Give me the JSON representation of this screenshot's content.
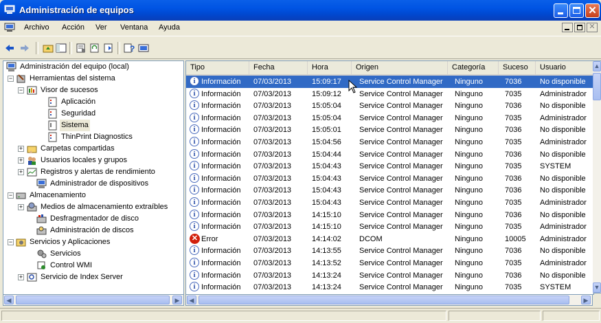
{
  "window": {
    "title": "Administración de equipos"
  },
  "menu": [
    "Archivo",
    "Acción",
    "Ver",
    "Ventana",
    "Ayuda"
  ],
  "toolbar": {
    "icons": [
      "back-arrow-icon",
      "forward-arrow-icon",
      "up-folder-icon",
      "show-tree-icon",
      "properties-icon",
      "refresh-icon",
      "export-icon",
      "help-icon",
      "console-icon"
    ]
  },
  "tree": {
    "root": "Administración del equipo (local)",
    "items": [
      "Herramientas del sistema",
      "Visor de sucesos",
      "Aplicación",
      "Seguridad",
      "Sistema",
      "ThinPrint Diagnostics",
      "Carpetas compartidas",
      "Usuarios locales y grupos",
      "Registros y alertas de rendimiento",
      "Administrador de dispositivos",
      "Almacenamiento",
      "Medios de almacenamiento extraíbles",
      "Desfragmentador de disco",
      "Administración de discos",
      "Servicios y Aplicaciones",
      "Servicios",
      "Control WMI",
      "Servicio de Index Server"
    ]
  },
  "columns": [
    "Tipo",
    "Fecha",
    "Hora",
    "Origen",
    "Categoría",
    "Suceso",
    "Usuario"
  ],
  "rows": [
    {
      "tipo": "Información",
      "fecha": "07/03/2013",
      "hora": "15:09:17",
      "origen": "Service Control Manager",
      "categoria": "Ninguno",
      "suceso": "7036",
      "usuario": "No disponible"
    },
    {
      "tipo": "Información",
      "fecha": "07/03/2013",
      "hora": "15:09:12",
      "origen": "Service Control Manager",
      "categoria": "Ninguno",
      "suceso": "7035",
      "usuario": "Administrador"
    },
    {
      "tipo": "Información",
      "fecha": "07/03/2013",
      "hora": "15:05:04",
      "origen": "Service Control Manager",
      "categoria": "Ninguno",
      "suceso": "7036",
      "usuario": "No disponible"
    },
    {
      "tipo": "Información",
      "fecha": "07/03/2013",
      "hora": "15:05:04",
      "origen": "Service Control Manager",
      "categoria": "Ninguno",
      "suceso": "7035",
      "usuario": "Administrador"
    },
    {
      "tipo": "Información",
      "fecha": "07/03/2013",
      "hora": "15:05:01",
      "origen": "Service Control Manager",
      "categoria": "Ninguno",
      "suceso": "7036",
      "usuario": "No disponible"
    },
    {
      "tipo": "Información",
      "fecha": "07/03/2013",
      "hora": "15:04:56",
      "origen": "Service Control Manager",
      "categoria": "Ninguno",
      "suceso": "7035",
      "usuario": "Administrador"
    },
    {
      "tipo": "Información",
      "fecha": "07/03/2013",
      "hora": "15:04:44",
      "origen": "Service Control Manager",
      "categoria": "Ninguno",
      "suceso": "7036",
      "usuario": "No disponible"
    },
    {
      "tipo": "Información",
      "fecha": "07/03/2013",
      "hora": "15:04:43",
      "origen": "Service Control Manager",
      "categoria": "Ninguno",
      "suceso": "7035",
      "usuario": "SYSTEM"
    },
    {
      "tipo": "Información",
      "fecha": "07/03/2013",
      "hora": "15:04:43",
      "origen": "Service Control Manager",
      "categoria": "Ninguno",
      "suceso": "7036",
      "usuario": "No disponible"
    },
    {
      "tipo": "Información",
      "fecha": "07/03/2013",
      "hora": "15:04:43",
      "origen": "Service Control Manager",
      "categoria": "Ninguno",
      "suceso": "7036",
      "usuario": "No disponible"
    },
    {
      "tipo": "Información",
      "fecha": "07/03/2013",
      "hora": "15:04:43",
      "origen": "Service Control Manager",
      "categoria": "Ninguno",
      "suceso": "7035",
      "usuario": "Administrador"
    },
    {
      "tipo": "Información",
      "fecha": "07/03/2013",
      "hora": "14:15:10",
      "origen": "Service Control Manager",
      "categoria": "Ninguno",
      "suceso": "7036",
      "usuario": "No disponible"
    },
    {
      "tipo": "Información",
      "fecha": "07/03/2013",
      "hora": "14:15:10",
      "origen": "Service Control Manager",
      "categoria": "Ninguno",
      "suceso": "7035",
      "usuario": "Administrador"
    },
    {
      "tipo": "Error",
      "fecha": "07/03/2013",
      "hora": "14:14:02",
      "origen": "DCOM",
      "categoria": "Ninguno",
      "suceso": "10005",
      "usuario": "Administrador"
    },
    {
      "tipo": "Información",
      "fecha": "07/03/2013",
      "hora": "14:13:55",
      "origen": "Service Control Manager",
      "categoria": "Ninguno",
      "suceso": "7036",
      "usuario": "No disponible"
    },
    {
      "tipo": "Información",
      "fecha": "07/03/2013",
      "hora": "14:13:52",
      "origen": "Service Control Manager",
      "categoria": "Ninguno",
      "suceso": "7035",
      "usuario": "Administrador"
    },
    {
      "tipo": "Información",
      "fecha": "07/03/2013",
      "hora": "14:13:24",
      "origen": "Service Control Manager",
      "categoria": "Ninguno",
      "suceso": "7036",
      "usuario": "No disponible"
    },
    {
      "tipo": "Información",
      "fecha": "07/03/2013",
      "hora": "14:13:24",
      "origen": "Service Control Manager",
      "categoria": "Ninguno",
      "suceso": "7035",
      "usuario": "SYSTEM"
    }
  ],
  "colors": {
    "selection": "#316ac5",
    "titlebar": "#0054e3"
  }
}
